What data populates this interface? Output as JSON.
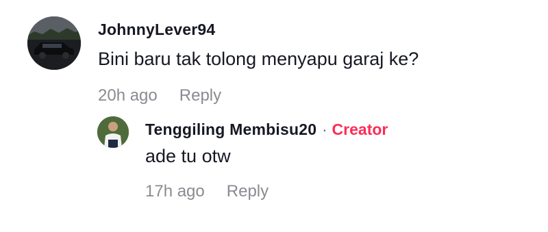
{
  "comments": [
    {
      "username": "JohnnyLever94",
      "text": "Bini baru tak tolong menyapu garaj ke?",
      "time": "20h ago",
      "reply_label": "Reply"
    }
  ],
  "reply": {
    "username": "Tenggiling Membisu20",
    "separator": "·",
    "badge": "Creator",
    "text": "ade tu otw",
    "time": "17h ago",
    "reply_label": "Reply"
  },
  "colors": {
    "creator_badge": "#fe2c55",
    "meta_text": "#8a8b91",
    "primary_text": "#161823"
  }
}
